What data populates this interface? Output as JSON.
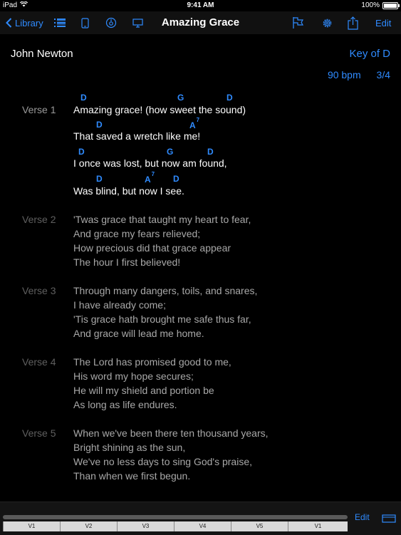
{
  "status": {
    "device": "iPad",
    "time": "9:41 AM",
    "battery": "100%",
    "battery_level": 1.0
  },
  "nav": {
    "back_label": "Library",
    "title": "Amazing Grace",
    "edit_label": "Edit"
  },
  "song": {
    "author": "John Newton",
    "key": "Key of D",
    "tempo": "90 bpm",
    "time_signature": "3/4"
  },
  "verses": [
    {
      "label": "Verse 1",
      "lines": [
        "Amazing grace! (how sweet the sound)",
        "That saved a wretch like me!",
        "I once was lost, but now am found,",
        "Was blind, but now I see."
      ]
    },
    {
      "label": "Verse 2",
      "lines": [
        "'Twas grace that taught my heart to fear,",
        "And grace my fears relieved;",
        "How precious did that grace appear",
        "The hour I first believed!"
      ]
    },
    {
      "label": "Verse 3",
      "lines": [
        "Through many dangers, toils, and snares,",
        "I have already come;",
        "'Tis grace hath brought me safe thus far,",
        "And grace will lead me home."
      ]
    },
    {
      "label": "Verse 4",
      "lines": [
        "The Lord has promised good to me,",
        "His word my hope secures;",
        "He will my shield and portion be",
        "As long as life endures."
      ]
    },
    {
      "label": "Verse 5",
      "lines": [
        "When we've been there ten thousand years,",
        "Bright shining as the sun,",
        "We've no less days to sing God's praise,",
        "Than when we first begun."
      ]
    }
  ],
  "chords": {
    "line1": [
      "D",
      "G",
      "D"
    ],
    "line2": [
      "D",
      "A",
      "7"
    ],
    "line3": [
      "D",
      "G",
      "D"
    ],
    "line4": [
      "D",
      "A",
      "7",
      "D"
    ]
  },
  "sections_bar": {
    "segments": [
      "V1",
      "V2",
      "V3",
      "V4",
      "V5",
      "V1"
    ],
    "edit_label": "Edit"
  },
  "colors": {
    "accent": "#2f8bff",
    "background": "#000000"
  }
}
